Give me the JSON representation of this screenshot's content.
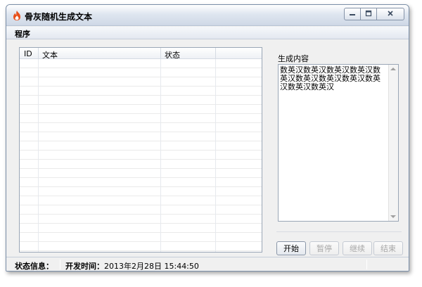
{
  "window": {
    "title": "骨灰随机生成文本",
    "icon": "flame-icon",
    "controls": [
      "minimize-icon",
      "restore-icon",
      "close-icon"
    ]
  },
  "menu": {
    "items": [
      {
        "label": "程序"
      }
    ]
  },
  "list": {
    "columns": [
      {
        "label": "ID"
      },
      {
        "label": "文本"
      },
      {
        "label": "状态"
      }
    ],
    "rows": []
  },
  "generated": {
    "label": "生成内容",
    "text": "数英汉数英汉数英汉数英汉数英汉数英汉数英汉数英汉数英汉数英汉数英汉"
  },
  "buttons": {
    "start": "开始",
    "pause": "暂停",
    "resume": "继续",
    "end": "结束"
  },
  "status": {
    "label": "状态信息：",
    "dev_time_label": "开发时间：",
    "dev_time_value": "2013年2月28日 15:44:50"
  },
  "colors": {
    "accent_flame": "#e8501a",
    "border": "#7a8ea8",
    "disabled_text": "#a8a8a8"
  }
}
